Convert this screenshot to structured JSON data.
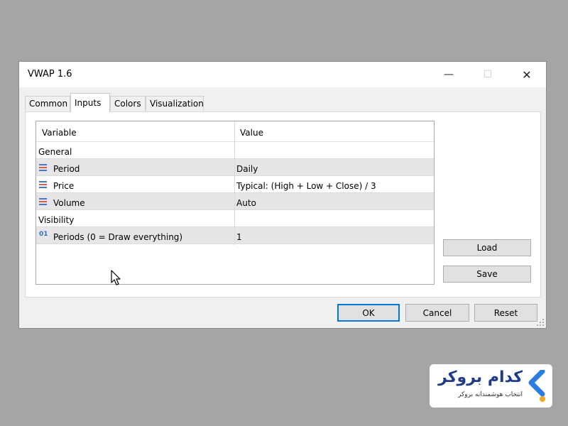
{
  "window": {
    "title": "VWAP 1.6",
    "controls": {
      "minimize": "—",
      "maximize": "☐",
      "close": "✕"
    }
  },
  "tabs": [
    {
      "label": "Common"
    },
    {
      "label": "Inputs",
      "active": true
    },
    {
      "label": "Colors"
    },
    {
      "label": "Visualization"
    }
  ],
  "table": {
    "headers": {
      "variable": "Variable",
      "value": "Value"
    },
    "rows": [
      {
        "variable": "General",
        "value": "",
        "icon": "none",
        "shaded": false
      },
      {
        "variable": "Period",
        "value": "Daily",
        "icon": "enum-icon",
        "shaded": true
      },
      {
        "variable": "Price",
        "value": "Typical: (High + Low + Close) / 3",
        "icon": "enum-icon",
        "shaded": false
      },
      {
        "variable": "Volume",
        "value": "Auto",
        "icon": "enum-icon",
        "shaded": true
      },
      {
        "variable": "Visibility",
        "value": "",
        "icon": "none",
        "shaded": false
      },
      {
        "variable": "Periods (0 = Draw everything)",
        "value": "1",
        "icon": "int-icon",
        "icon_text": "01",
        "shaded": true
      }
    ]
  },
  "side_buttons": {
    "load": "Load",
    "save": "Save"
  },
  "bottom_buttons": {
    "ok": "OK",
    "cancel": "Cancel",
    "reset": "Reset"
  },
  "watermark": {
    "title": "کدام بروکر",
    "subtitle": "انتخاب هوشمندانه بروکر",
    "colors": {
      "brand_blue": "#1f3c88",
      "accent_blue": "#2a7de1",
      "dot": "#f5a623"
    }
  },
  "colors": {
    "backdrop": "#a5a5a5",
    "dialog_bg": "#f0f0f0",
    "row_shade": "#e6e6e6",
    "default_button_border": "#0078d7",
    "enum_icon_blue": "#4a78c9",
    "enum_icon_red": "#e0584f"
  }
}
